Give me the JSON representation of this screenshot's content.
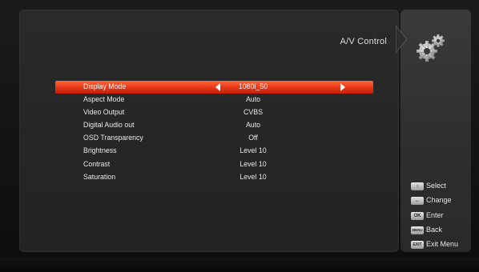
{
  "header": {
    "title": "A/V Control"
  },
  "menu": {
    "rows": [
      {
        "label": "Display Mode",
        "value": "1080i_50",
        "selected": true
      },
      {
        "label": "Aspect Mode",
        "value": "Auto"
      },
      {
        "label": "Video Output",
        "value": "CVBS"
      },
      {
        "label": "Digital Audio out",
        "value": "Auto"
      },
      {
        "label": "OSD Transparency",
        "value": "Off"
      },
      {
        "label": "Brightness",
        "value": "Level 10"
      },
      {
        "label": "Contrast",
        "value": "Level 10"
      },
      {
        "label": "Saturation",
        "value": "Level 10"
      }
    ]
  },
  "legend": {
    "items": [
      {
        "key": "↕",
        "label": "Select"
      },
      {
        "key": "↔",
        "label": "Change"
      },
      {
        "key": "OK",
        "label": "Enter"
      },
      {
        "key": "MENU",
        "label": "Back"
      },
      {
        "key": "EXIT",
        "label": "Exit Menu"
      }
    ]
  },
  "icons": {
    "settings": "gears-icon"
  },
  "colors": {
    "highlight": "#e8391a",
    "panel": "#262626"
  }
}
